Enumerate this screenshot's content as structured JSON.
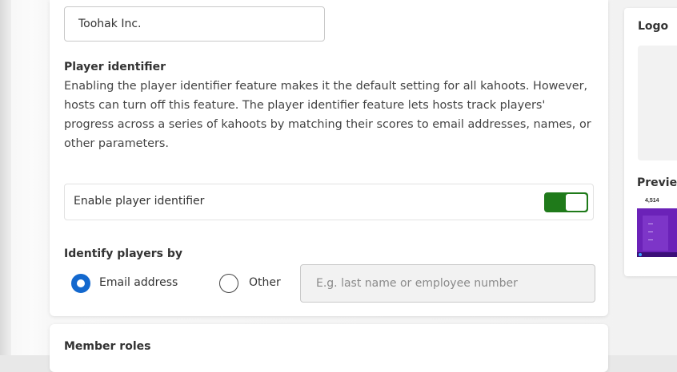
{
  "company": {
    "name_value": "Toohak Inc."
  },
  "player_identifier": {
    "title": "Player identifier",
    "description": "Enabling the player identifier feature makes it the default setting for all kahoots. However, hosts can turn off this feature. The player identifier feature lets hosts track players' progress across a series of kahoots by matching their scores to email addresses, names, or other parameters.",
    "toggle_label": "Enable player identifier",
    "toggle_on": true
  },
  "identify_by": {
    "title": "Identify players by",
    "options": [
      {
        "label": "Email address",
        "selected": true
      },
      {
        "label": "Other",
        "selected": false
      }
    ],
    "other_placeholder": "E.g. last name or employee number"
  },
  "member_roles": {
    "title": "Member roles"
  },
  "side_panel": {
    "logo_title": "Logo",
    "preview_title": "Previe",
    "preview_score": "4,514"
  },
  "colors": {
    "toggle_on": "#1f7a1a",
    "radio_selected": "#1368ce",
    "preview_bg": "#6b22b8"
  }
}
